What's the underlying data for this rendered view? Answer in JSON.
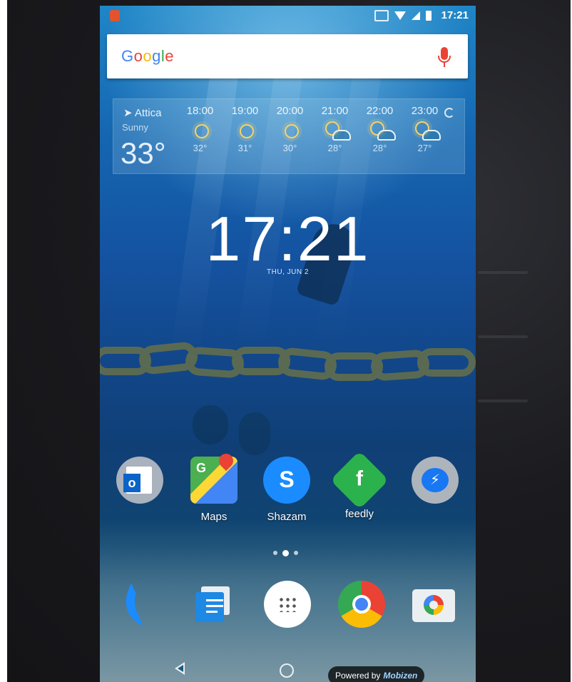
{
  "status": {
    "time": "17:21",
    "icons": [
      "notification-icon",
      "cast-icon",
      "wifi-icon",
      "signal-icon",
      "battery-icon"
    ]
  },
  "search": {
    "logo": [
      "G",
      "o",
      "o",
      "g",
      "l",
      "e"
    ]
  },
  "weather": {
    "location": "Attica",
    "condition": "Sunny",
    "temperature": "33°",
    "forecast": [
      {
        "hour": "18:00",
        "temp": "32°",
        "icon": "sun-icon"
      },
      {
        "hour": "19:00",
        "temp": "31°",
        "icon": "sun-icon"
      },
      {
        "hour": "20:00",
        "temp": "30°",
        "icon": "sun-icon"
      },
      {
        "hour": "21:00",
        "temp": "28°",
        "icon": "partly-cloudy-icon"
      },
      {
        "hour": "22:00",
        "temp": "28°",
        "icon": "partly-cloudy-icon"
      },
      {
        "hour": "23:00",
        "temp": "27°",
        "icon": "partly-cloudy-icon"
      }
    ]
  },
  "clock": {
    "time": "17:21",
    "date": "THU, JUN 2"
  },
  "apps": [
    {
      "name": "outlook",
      "label": ""
    },
    {
      "name": "maps",
      "label": "Maps"
    },
    {
      "name": "shazam",
      "label": "Shazam"
    },
    {
      "name": "feedly",
      "label": "feedly"
    },
    {
      "name": "messenger",
      "label": ""
    }
  ],
  "dock": [
    "phone-icon",
    "messages-icon",
    "app-launcher-icon",
    "chrome-icon",
    "camera-icon"
  ],
  "nav": {
    "powered_prefix": "Powered by",
    "powered_brand": "Mobizen"
  },
  "colors": {
    "google_blue": "#4285f4",
    "google_red": "#ea4335",
    "google_yellow": "#fbbc05",
    "google_green": "#34a853"
  }
}
